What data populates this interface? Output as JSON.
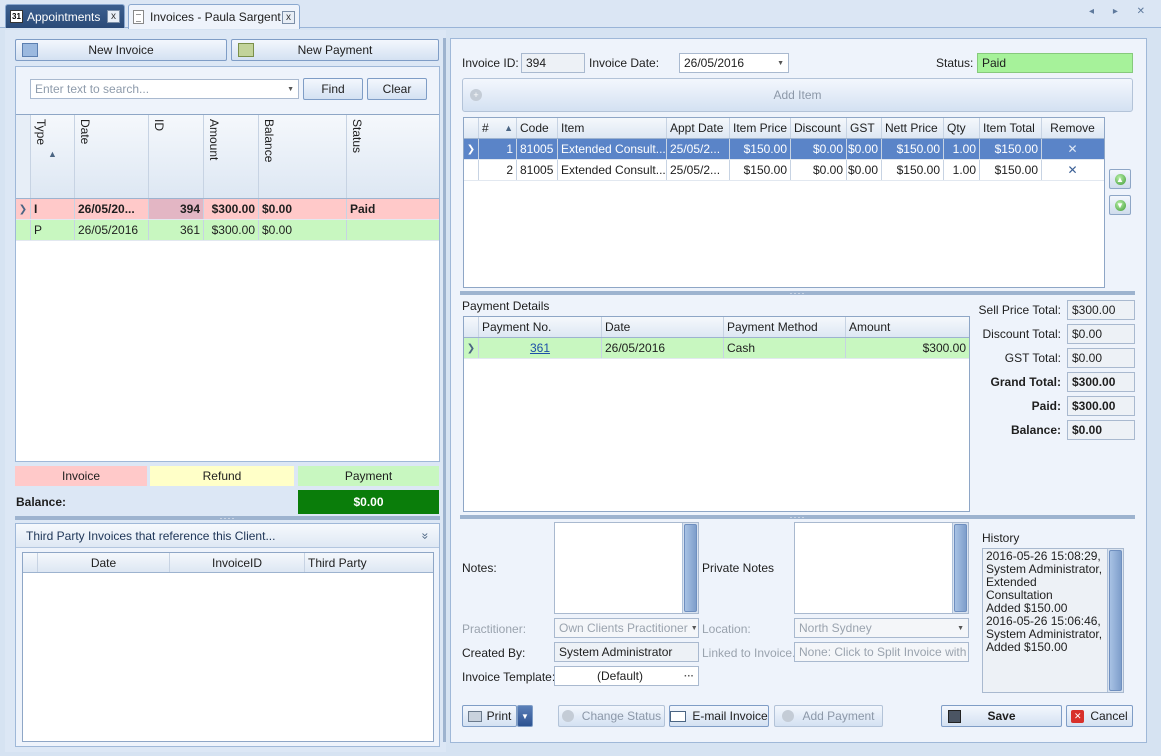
{
  "tabs": [
    {
      "label": "Appointments",
      "icon": "calendar-icon",
      "icon_text": "31",
      "close": "x"
    },
    {
      "label": "Invoices - Paula Sargent",
      "icon": "document-icon",
      "close": "x"
    }
  ],
  "nav_arrows": "◂ ▸ ✕",
  "left": {
    "new_invoice_label": "New Invoice",
    "new_payment_label": "New Payment",
    "search": {
      "placeholder": "Enter text to search...",
      "value": ""
    },
    "find_label": "Find",
    "clear_label": "Clear",
    "columns": [
      "Type",
      "Date",
      "ID",
      "Amount",
      "Balance",
      "Status"
    ],
    "rows": [
      {
        "type": "I",
        "date": "26/05/20...",
        "id": "394",
        "amount": "$300.00",
        "balance": "$0.00",
        "status": "Paid",
        "color": "#ffc9c9"
      },
      {
        "type": "P",
        "date": "26/05/2016",
        "id": "361",
        "amount": "$300.00",
        "balance": "$0.00",
        "status": "",
        "color": "#c8f7c0"
      }
    ],
    "legend": [
      {
        "label": "Invoice",
        "color": "#ffc9c9"
      },
      {
        "label": "Refund",
        "color": "#ffffc8"
      },
      {
        "label": "Payment",
        "color": "#c8f7c0"
      }
    ],
    "balance_label": "Balance:",
    "balance_value": "$0.00",
    "third_party": {
      "title": "Third Party Invoices that reference this Client...",
      "collapse_glyph": "»",
      "columns": [
        "Date",
        "InvoiceID",
        "Third Party"
      ]
    }
  },
  "invoice": {
    "id_label": "Invoice ID:",
    "id_value": "394",
    "date_label": "Invoice Date:",
    "date_value": "26/05/2016",
    "status_label": "Status:",
    "status_value": "Paid",
    "add_item_label": "Add Item",
    "items_columns": [
      "#",
      "Code",
      "Item",
      "Appt Date",
      "Item Price",
      "Discount",
      "GST",
      "Nett Price",
      "Qty",
      "Item Total",
      "Remove"
    ],
    "items": [
      {
        "num": "1",
        "code": "81005",
        "item": "Extended Consult...",
        "appt_date": "25/05/2...",
        "item_price": "$150.00",
        "discount": "$0.00",
        "gst": "$0.00",
        "nett_price": "$150.00",
        "qty": "1.00",
        "item_total": "$150.00",
        "remove": "✕"
      },
      {
        "num": "2",
        "code": "81005",
        "item": "Extended Consult...",
        "appt_date": "25/05/2...",
        "item_price": "$150.00",
        "discount": "$0.00",
        "gst": "$0.00",
        "nett_price": "$150.00",
        "qty": "1.00",
        "item_total": "$150.00",
        "remove": "✕"
      }
    ],
    "sort_glyph": "▲"
  },
  "payments": {
    "title": "Payment Details",
    "columns": [
      "Payment No.",
      "Date",
      "Payment Method",
      "Amount"
    ],
    "rows": [
      {
        "payment_no": "361",
        "date": "26/05/2016",
        "method": "Cash",
        "amount": "$300.00"
      }
    ]
  },
  "totals": [
    {
      "label": "Sell Price Total:",
      "value": "$300.00",
      "bold": false
    },
    {
      "label": "Discount Total:",
      "value": "$0.00",
      "bold": false
    },
    {
      "label": "GST Total:",
      "value": "$0.00",
      "bold": false
    },
    {
      "label": "Grand Total:",
      "value": "$300.00",
      "bold": true
    },
    {
      "label": "Paid:",
      "value": "$300.00",
      "bold": true
    },
    {
      "label": "Balance:",
      "value": "$0.00",
      "bold": true
    }
  ],
  "details": {
    "notes_label": "Notes:",
    "private_notes_label": "Private Notes",
    "practitioner_label": "Practitioner:",
    "practitioner_value": "Own Clients Practitioner",
    "location_label": "Location:",
    "location_value": "North Sydney",
    "created_by_label": "Created By:",
    "created_by_value": "System Administrator",
    "linked_label": "Linked to Invoice.",
    "linked_value": "None: Click to Split Invoice with ...",
    "template_label": "Invoice Template:",
    "template_value": "(Default)",
    "template_ellipsis": "···",
    "history_label": "History",
    "history_lines": [
      "2016-05-26 15:08:29,",
      "System Administrator,",
      "Extended Consultation",
      "Added $150.00",
      "2016-05-26 15:06:46,",
      "System Administrator,",
      "Added $150.00"
    ]
  },
  "buttons": {
    "print": "Print",
    "change_status": "Change Status",
    "email_invoice": "E-mail Invoice",
    "add_payment": "Add Payment",
    "save": "Save",
    "cancel": "Cancel"
  },
  "colors": {
    "selected_row": "#5a84c8",
    "status_paid": "#a6f29a",
    "balance_green": "#0a7d0a",
    "invoice_pink": "#ffc9c9",
    "payment_green": "#c8f7c0",
    "refund_yellow": "#ffffc8"
  }
}
